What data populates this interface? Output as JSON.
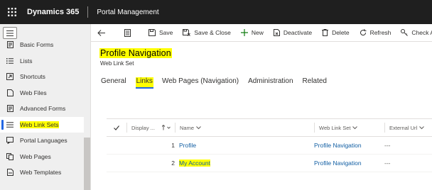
{
  "topbar": {
    "app_title": "Dynamics 365",
    "app_name": "Portal Management"
  },
  "sidebar": {
    "items": [
      {
        "label": "Basic Forms",
        "icon": "form-icon"
      },
      {
        "label": "Lists",
        "icon": "list-icon"
      },
      {
        "label": "Shortcuts",
        "icon": "shortcut-icon"
      },
      {
        "label": "Web Files",
        "icon": "file-icon"
      },
      {
        "label": "Advanced Forms",
        "icon": "form-icon"
      },
      {
        "label": "Web Link Sets",
        "icon": "list-icon",
        "selected": true,
        "highlighted": true
      },
      {
        "label": "Portal Languages",
        "icon": "language-icon"
      },
      {
        "label": "Web Pages",
        "icon": "web-page-icon"
      },
      {
        "label": "Web Templates",
        "icon": "template-icon"
      }
    ]
  },
  "commands": {
    "save": "Save",
    "save_close": "Save & Close",
    "new": "New",
    "deactivate": "Deactivate",
    "delete": "Delete",
    "refresh": "Refresh",
    "check_access": "Check Acc"
  },
  "record": {
    "title": "Profile Navigation",
    "entity": "Web Link Set"
  },
  "tabs": [
    {
      "label": "General"
    },
    {
      "label": "Links",
      "active": true
    },
    {
      "label": "Web Pages (Navigation)"
    },
    {
      "label": "Administration"
    },
    {
      "label": "Related"
    }
  ],
  "grid": {
    "columns": {
      "display": "Display ...",
      "name": "Name",
      "web_link_set": "Web Link Set",
      "external_url": "External Url"
    },
    "rows": [
      {
        "display": "1",
        "name": "Profile",
        "web_link_set": "Profile Navigation",
        "external_url": "---"
      },
      {
        "display": "2",
        "name": "My Account",
        "web_link_set": "Profile Navigation",
        "external_url": "---",
        "highlighted": true
      }
    ]
  },
  "colors": {
    "highlight": "#ffff00",
    "accent": "#2266e3",
    "topbar": "#1f1f1f",
    "link": "#115ea3"
  }
}
